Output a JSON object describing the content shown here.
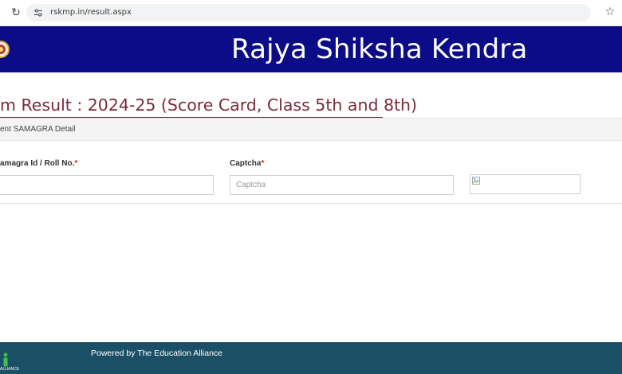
{
  "browser": {
    "url": "rskmp.in/result.aspx",
    "reload_glyph": "↻",
    "bookmark_glyph": "☆",
    "icons": [
      "reload-icon",
      "site-settings-icon",
      "bookmark-star-icon"
    ]
  },
  "header": {
    "title": "Rajya Shiksha Kendra",
    "background_color": "#0c0c88",
    "logo_icon": "emblem-logo-icon"
  },
  "main": {
    "heading": "m Result : 2024-25 (Score Card, Class 5th and 8th)",
    "heading_color": "#7b2a3a",
    "panel_title": "ent SAMAGRA Detail",
    "fields": {
      "samagra": {
        "label": "amagra Id / Roll No.",
        "required_mark": "*",
        "value": "",
        "placeholder": ""
      },
      "captcha": {
        "label": "Captcha",
        "required_mark": "*",
        "value": "",
        "placeholder": "Captcha"
      }
    },
    "captcha_image_icon": "broken-image-icon"
  },
  "footer": {
    "text": "Powered by The Education Alliance",
    "logo_caption": "ALLIANCE",
    "background_color": "#1b4f66"
  }
}
